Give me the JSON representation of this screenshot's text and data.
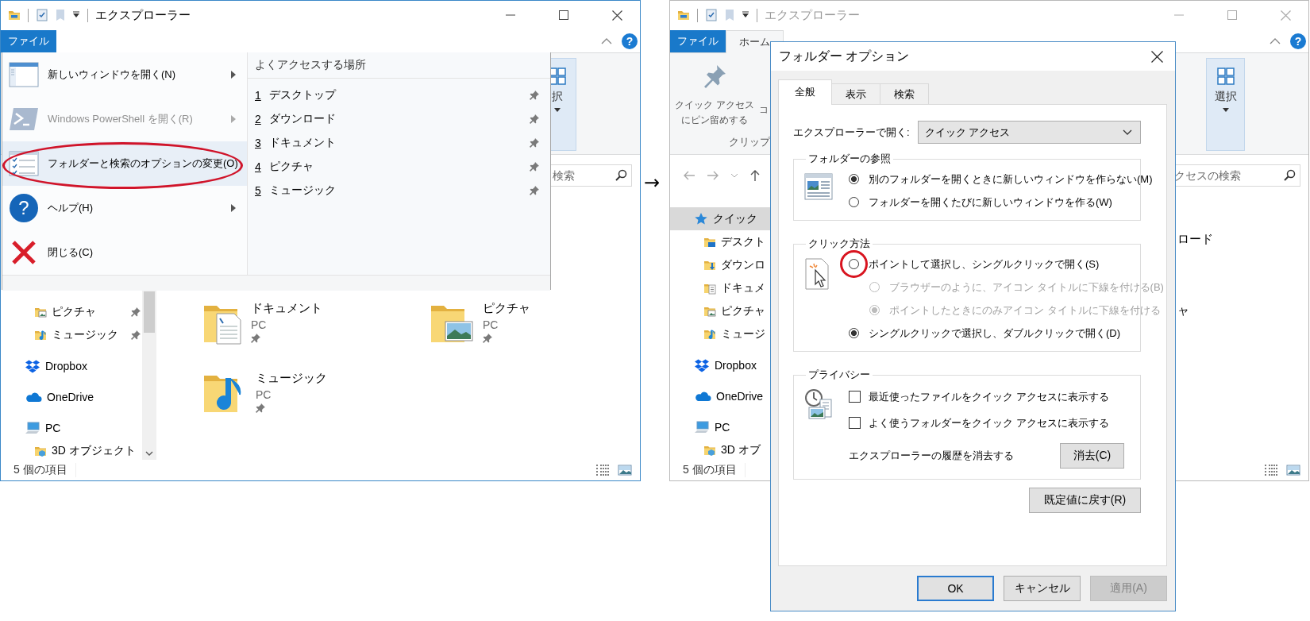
{
  "left_window": {
    "title": "エクスプローラー",
    "active": true,
    "help_glyph": "?",
    "tabs": [
      {
        "label": "ファイル",
        "kind": "file",
        "selected": false
      }
    ],
    "ribbon": [
      {
        "kind": "select",
        "label": "択"
      }
    ],
    "search": {
      "placeholder": "検索"
    },
    "nav": [
      {
        "children": [
          {
            "label": "ピクチャ",
            "kind": "pictures",
            "pinned": true,
            "selected": false
          },
          {
            "label": "ミュージック",
            "kind": "music",
            "pinned": true,
            "selected": false
          }
        ]
      },
      {
        "label": "Dropbox",
        "kind": "dropbox",
        "selected": false
      },
      {
        "label": "OneDrive",
        "kind": "onedrive",
        "selected": false
      },
      {
        "label": "PC",
        "kind": "pc",
        "selected": false,
        "children": [
          {
            "label": "3D オブジェクト",
            "kind": "objects3d",
            "selected": false
          }
        ]
      }
    ],
    "tiles": [
      {
        "name": "ドキュメント",
        "location": "PC",
        "kind": "documents",
        "pinned": true
      },
      {
        "name": "ピクチャ",
        "location": "PC",
        "kind": "pictures",
        "pinned": true
      },
      {
        "name": "ミュージック",
        "location": "PC",
        "kind": "music",
        "pinned": true
      }
    ],
    "status": "5 個の項目"
  },
  "file_menu": {
    "items": [
      {
        "label": "新しいウィンドウを開く(N)",
        "kind": "window",
        "submenu": true,
        "disabled": false,
        "highlighted": false,
        "annotated": false
      },
      {
        "label": "Windows PowerShell を開く(R)",
        "kind": "powershell",
        "submenu": true,
        "disabled": true,
        "highlighted": false,
        "annotated": false
      },
      {
        "label": "フォルダーと検索のオプションの変更(O)",
        "kind": "options",
        "submenu": false,
        "disabled": false,
        "highlighted": true,
        "annotated": true
      },
      {
        "label": "ヘルプ(H)",
        "kind": "help",
        "glyph": "?",
        "submenu": true,
        "disabled": false,
        "highlighted": false,
        "annotated": false
      },
      {
        "label": "閉じる(C)",
        "kind": "close",
        "submenu": false,
        "disabled": false,
        "highlighted": false,
        "annotated": false
      }
    ],
    "recent_heading": "よくアクセスする場所",
    "recent": [
      {
        "number": "1",
        "label": "デスクトップ",
        "pinned": true
      },
      {
        "number": "2",
        "label": "ダウンロード",
        "pinned": true
      },
      {
        "number": "3",
        "label": "ドキュメント",
        "pinned": true
      },
      {
        "number": "4",
        "label": "ピクチャ",
        "pinned": true
      },
      {
        "number": "5",
        "label": "ミュージック",
        "pinned": true
      }
    ]
  },
  "arrow": "→",
  "right_window": {
    "title": "エクスプローラー",
    "active": false,
    "help_glyph": "?",
    "tabs": [
      {
        "label": "ファイル",
        "kind": "file",
        "selected": false
      },
      {
        "label": "ホーム",
        "kind": "tab",
        "selected": true
      }
    ],
    "ribbon": [
      {
        "kind": "pin",
        "lines": [
          "クイック アクセス",
          "にピン留めする"
        ]
      },
      {
        "kind": "partial",
        "label": "コ"
      },
      {
        "kind": "group",
        "label": "クリップ"
      },
      {
        "kind": "select",
        "label": "選択"
      }
    ],
    "address": {
      "nav_arrows": true
    },
    "search": {
      "placeholder": "クセスの検索"
    },
    "nav": [
      {
        "label": "クイック",
        "kind": "star",
        "selected": true,
        "children": [
          {
            "label": "デスクト",
            "kind": "desktop",
            "selected": false
          },
          {
            "label": "ダウンロ",
            "kind": "downloads",
            "selected": false
          },
          {
            "label": "ドキュメ",
            "kind": "documents",
            "selected": false
          },
          {
            "label": "ピクチャ",
            "kind": "pictures",
            "selected": false
          },
          {
            "label": "ミュージ",
            "kind": "music",
            "selected": false
          }
        ]
      },
      {
        "label": "Dropbox",
        "kind": "dropbox",
        "selected": false
      },
      {
        "label": "OneDrive",
        "kind": "onedrive",
        "selected": false
      },
      {
        "label": "PC",
        "kind": "pc",
        "selected": false,
        "children": [
          {
            "label": "3D オブ",
            "kind": "objects3d",
            "selected": false
          }
        ]
      }
    ],
    "tiles": [
      {
        "name": "ロード"
      },
      {
        "name": "ャ"
      }
    ],
    "status": "5 個の項目"
  },
  "folder_options": {
    "title": "フォルダー オプション",
    "tabs": [
      {
        "label": "全般",
        "selected": true
      },
      {
        "label": "表示",
        "selected": false
      },
      {
        "label": "検索",
        "selected": false
      }
    ],
    "open_in": {
      "label": "エクスプローラーで開く:",
      "value": "クイック アクセス"
    },
    "groups": [
      {
        "title": "フォルダーの参照",
        "kind": "browse",
        "options": [
          {
            "kind": "radio",
            "label": "別のフォルダーを開くときに新しいウィンドウを作らない(M)",
            "selected": true,
            "disabled": false,
            "annotated": false
          },
          {
            "kind": "radio",
            "label": "フォルダーを開くたびに新しいウィンドウを作る(W)",
            "selected": false,
            "disabled": false,
            "annotated": false
          }
        ]
      },
      {
        "title": "クリック方法",
        "kind": "click",
        "options": [
          {
            "kind": "radio",
            "label": "ポイントして選択し、シングルクリックで開く(S)",
            "selected": false,
            "disabled": false,
            "annotated": true,
            "children": [
              {
                "kind": "radio",
                "label": "ブラウザーのように、アイコン タイトルに下線を付ける(B)",
                "selected": false,
                "disabled": true,
                "annotated": false
              },
              {
                "kind": "radio",
                "label": "ポイントしたときにのみアイコン タイトルに下線を付ける",
                "selected": true,
                "disabled": true,
                "annotated": false
              }
            ]
          },
          {
            "kind": "radio",
            "label": "シングルクリックで選択し、ダブルクリックで開く(D)",
            "selected": true,
            "disabled": false,
            "annotated": false
          }
        ]
      },
      {
        "title": "プライバシー",
        "kind": "privacy",
        "options": [
          {
            "kind": "checkbox",
            "label": "最近使ったファイルをクイック アクセスに表示する",
            "checked": false
          },
          {
            "kind": "checkbox",
            "label": "よく使うフォルダーをクイック アクセスに表示する",
            "checked": false
          },
          {
            "kind": "action",
            "label": "エクスプローラーの履歴を消去する",
            "button": "消去(C)"
          }
        ]
      }
    ],
    "restore_button": "既定値に戻す(R)",
    "buttons": [
      {
        "label": "OK",
        "default": true,
        "disabled": false
      },
      {
        "label": "キャンセル",
        "default": false,
        "disabled": false
      },
      {
        "label": "適用(A)",
        "default": false,
        "disabled": true
      }
    ]
  }
}
